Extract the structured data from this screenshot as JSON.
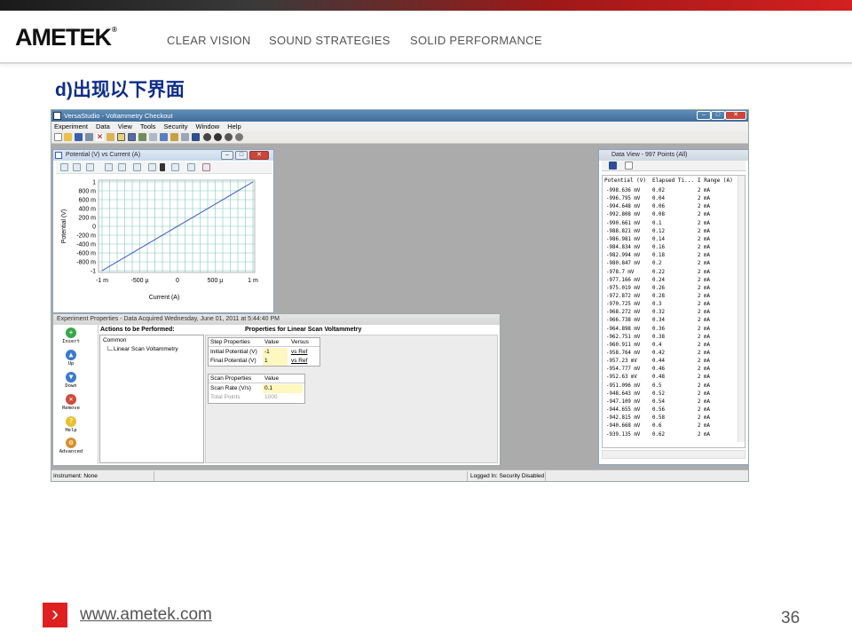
{
  "header": {
    "logo": "AMETEK",
    "logo_mark": "®",
    "taglines": [
      "CLEAR VISION",
      "SOUND STRATEGIES",
      "SOLID PERFORMANCE"
    ],
    "accent_color": "#d42020"
  },
  "slide_title": "d)出现以下界面",
  "app": {
    "title": "VersaStudio - Voltammetry Checkout",
    "menu": [
      "Experiment",
      "Data",
      "View",
      "Tools",
      "Security",
      "Window",
      "Help"
    ],
    "status_left": "Instrument: None",
    "status_right": "Logged In: Security Disabled"
  },
  "plot_window": {
    "title": "Potential (V) vs Current (A)",
    "chart_data": {
      "type": "line",
      "xlabel": "Current (A)",
      "ylabel": "Potential (V)",
      "xticks": [
        "-1 m",
        "-500 µ",
        "0",
        "500 µ",
        "1 m"
      ],
      "yticks": [
        "1",
        "800 m",
        "600 m",
        "400 m",
        "200 m",
        "0",
        "-200 m",
        "-400 m",
        "-600 m",
        "-800 m",
        "-1"
      ],
      "xlim": [
        -0.001,
        0.001
      ],
      "ylim": [
        -1,
        1
      ],
      "series": [
        {
          "x": [
            -0.001,
            0.001
          ],
          "y": [
            -1,
            1
          ],
          "color": "#3a56c4"
        }
      ],
      "grid": true
    }
  },
  "data_view": {
    "title": "Data View - 997 Points (All)",
    "columns": [
      "Potential (V)",
      "Elapsed Ti...",
      "I Range (A)"
    ],
    "rows": [
      [
        "-998.636 mV",
        "0.02",
        "2 mA"
      ],
      [
        "-996.795 mV",
        "0.04",
        "2 mA"
      ],
      [
        "-994.648 mV",
        "0.06",
        "2 mA"
      ],
      [
        "-992.808 mV",
        "0.08",
        "2 mA"
      ],
      [
        "-990.661 mV",
        "0.1",
        "2 mA"
      ],
      [
        "-988.821 mV",
        "0.12",
        "2 mA"
      ],
      [
        "-986.981 mV",
        "0.14",
        "2 mA"
      ],
      [
        "-984.834 mV",
        "0.16",
        "2 mA"
      ],
      [
        "-982.994 mV",
        "0.18",
        "2 mA"
      ],
      [
        "-980.847 mV",
        "0.2",
        "2 mA"
      ],
      [
        "-978.7 mV",
        "0.22",
        "2 mA"
      ],
      [
        "-977.166 mV",
        "0.24",
        "2 mA"
      ],
      [
        "-975.019 mV",
        "0.26",
        "2 mA"
      ],
      [
        "-972.872 mV",
        "0.28",
        "2 mA"
      ],
      [
        "-970.725 mV",
        "0.3",
        "2 mA"
      ],
      [
        "-968.272 mV",
        "0.32",
        "2 mA"
      ],
      [
        "-966.738 mV",
        "0.34",
        "2 mA"
      ],
      [
        "-964.898 mV",
        "0.36",
        "2 mA"
      ],
      [
        "-962.751 mV",
        "0.38",
        "2 mA"
      ],
      [
        "-960.911 mV",
        "0.4",
        "2 mA"
      ],
      [
        "-958.764 mV",
        "0.42",
        "2 mA"
      ],
      [
        "-957.23 mV",
        "0.44",
        "2 mA"
      ],
      [
        "-954.777 mV",
        "0.46",
        "2 mA"
      ],
      [
        "-952.63 mV",
        "0.48",
        "2 mA"
      ],
      [
        "-951.096 mV",
        "0.5",
        "2 mA"
      ],
      [
        "-948.643 mV",
        "0.52",
        "2 mA"
      ],
      [
        "-947.109 mV",
        "0.54",
        "2 mA"
      ],
      [
        "-944.655 mV",
        "0.56",
        "2 mA"
      ],
      [
        "-942.815 mV",
        "0.58",
        "2 mA"
      ],
      [
        "-940.668 mV",
        "0.6",
        "2 mA"
      ],
      [
        "-939.135 mV",
        "0.62",
        "2 mA"
      ]
    ]
  },
  "properties": {
    "title": "Experiment Properties - Data Acquired Wednesday, June 01, 2011 at 5:44:40 PM",
    "actions_header": "Actions to be Performed:",
    "props_header": "Properties for Linear Scan Voltammetry",
    "tree": [
      "Common",
      "Linear Scan Voltammetry"
    ],
    "side_buttons": [
      "Insert",
      "Up",
      "Down",
      "Remove",
      "Help",
      "Advanced"
    ],
    "step_table": {
      "headers": [
        "Step Properties",
        "Value",
        "Versus"
      ],
      "rows": [
        [
          "Initial Potential (V)",
          "-1",
          "vs Ref"
        ],
        [
          "Final Potential (V)",
          "1",
          "vs Ref"
        ]
      ]
    },
    "scan_table": {
      "headers": [
        "Scan Properties",
        "Value"
      ],
      "rows": [
        [
          "Scan Rate (V/s)",
          "0.1"
        ],
        [
          "Total Points",
          "1000"
        ]
      ]
    }
  },
  "footer": {
    "url": "www.ametek.com",
    "page": "36",
    "arrow": "›"
  }
}
